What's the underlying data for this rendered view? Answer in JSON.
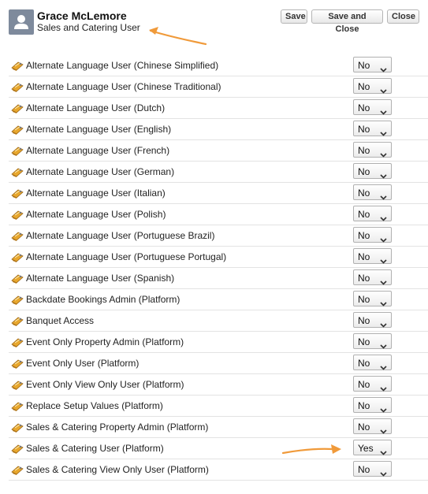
{
  "user": {
    "name": "Grace McLemore",
    "role": "Sales and Catering User"
  },
  "toolbar": {
    "save_label": "Save",
    "save_close_label": "Save and Close",
    "close_label": "Close"
  },
  "icons": {
    "avatar": "person-icon",
    "row": "permission-set-icon",
    "select": "chevron-down-icon",
    "annotation": "orange-arrow"
  },
  "colors": {
    "annotation_arrow": "#f09a3a",
    "avatar_bg": "#7e8a9c"
  },
  "permissions": [
    {
      "label": "Alternate Language User (Chinese Simplified)",
      "value": "No"
    },
    {
      "label": "Alternate Language User (Chinese Traditional)",
      "value": "No"
    },
    {
      "label": "Alternate Language User (Dutch)",
      "value": "No"
    },
    {
      "label": "Alternate Language User (English)",
      "value": "No"
    },
    {
      "label": "Alternate Language User (French)",
      "value": "No"
    },
    {
      "label": "Alternate Language User (German)",
      "value": "No"
    },
    {
      "label": "Alternate Language User (Italian)",
      "value": "No"
    },
    {
      "label": "Alternate Language User (Polish)",
      "value": "No"
    },
    {
      "label": "Alternate Language User (Portuguese Brazil)",
      "value": "No"
    },
    {
      "label": "Alternate Language User (Portuguese Portugal)",
      "value": "No"
    },
    {
      "label": "Alternate Language User (Spanish)",
      "value": "No"
    },
    {
      "label": "Backdate Bookings Admin (Platform)",
      "value": "No"
    },
    {
      "label": "Banquet Access",
      "value": "No"
    },
    {
      "label": "Event Only Property Admin (Platform)",
      "value": "No"
    },
    {
      "label": "Event Only User (Platform)",
      "value": "No"
    },
    {
      "label": "Event Only View Only User (Platform)",
      "value": "No"
    },
    {
      "label": "Replace Setup Values (Platform)",
      "value": "No"
    },
    {
      "label": "Sales & Catering Property Admin (Platform)",
      "value": "No"
    },
    {
      "label": "Sales & Catering User (Platform)",
      "value": "Yes"
    },
    {
      "label": "Sales & Catering View Only User (Platform)",
      "value": "No"
    }
  ]
}
